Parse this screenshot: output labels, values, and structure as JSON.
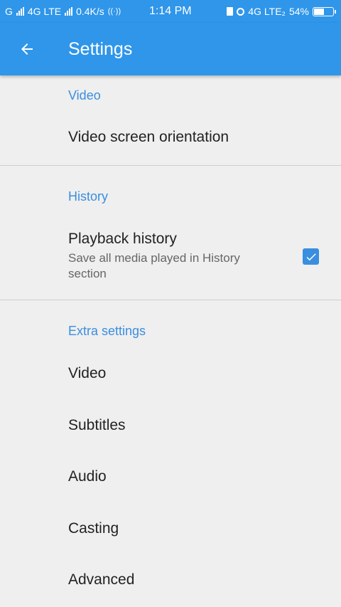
{
  "status_bar": {
    "network_left": "G",
    "network_mid": "4G LTE",
    "speed": "0.4K/s",
    "time": "1:14 PM",
    "network_right": "4G LTE₂",
    "battery_percent_text": "54%",
    "battery_level": 0.54
  },
  "app_bar": {
    "title": "Settings",
    "back_icon": "arrow-left-icon",
    "color": "#2f96ea"
  },
  "sections": {
    "video": {
      "header": "Video",
      "items": [
        {
          "title": "Video screen orientation"
        }
      ]
    },
    "history": {
      "header": "History",
      "playback": {
        "title": "Playback history",
        "subtitle": "Save all media played in History section",
        "checked": true
      }
    },
    "extra": {
      "header": "Extra settings",
      "items": [
        {
          "title": "Video"
        },
        {
          "title": "Subtitles"
        },
        {
          "title": "Audio"
        },
        {
          "title": "Casting"
        },
        {
          "title": "Advanced"
        }
      ]
    }
  },
  "colors": {
    "accent": "#3a8ee0",
    "background": "#efefef"
  }
}
